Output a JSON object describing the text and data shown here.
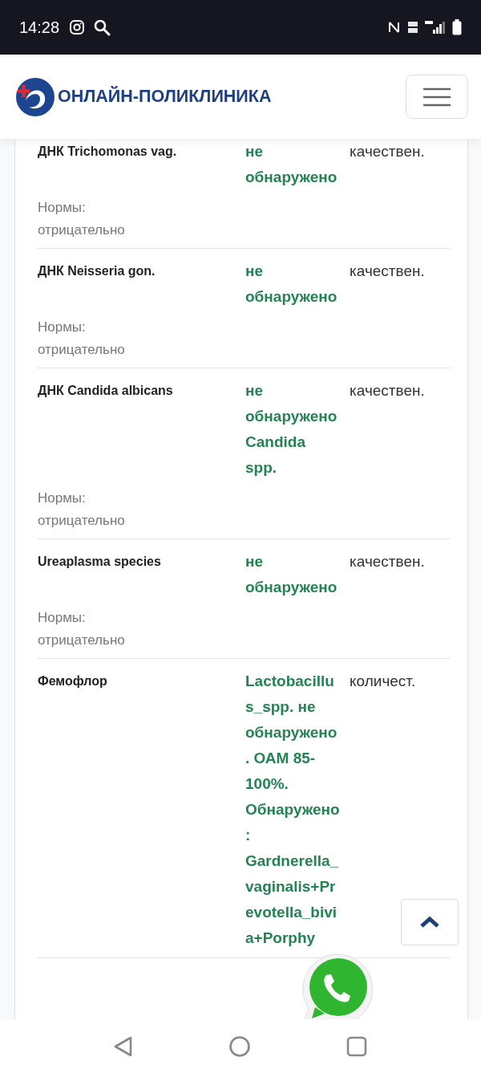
{
  "status_bar": {
    "time": "14:28"
  },
  "header": {
    "logo_text": "ОНЛАЙН-ПОЛИКЛИНИКА"
  },
  "results": [
    {
      "name": "ДНК Trichomonas vag.",
      "result": "не обнаружено",
      "unit": "качествен.",
      "norm_label": "Нормы:",
      "norm": "отрицательно"
    },
    {
      "name": "ДНК Neisseria gon.",
      "result": "не обнаружено",
      "unit": "качествен.",
      "norm_label": "Нормы:",
      "norm": "отрицательно"
    },
    {
      "name": "ДНК Candida albicans",
      "result": "не обнаружено Candida spp.",
      "unit": "качествен.",
      "norm_label": "Нормы:",
      "norm": "отрицательно"
    },
    {
      "name": "Ureaplasma species",
      "result": "не обнаружено",
      "unit": "качествен.",
      "norm_label": "Нормы:",
      "norm": "отрицательно"
    },
    {
      "name": "Фемофлор",
      "result": "Lactobacillus_spp. не обнаружено. ОАМ 85-100%. Обнаружено: Gardnerella_vaginalis+Prevotella_bivia+Porphy",
      "unit": "количест."
    }
  ]
}
